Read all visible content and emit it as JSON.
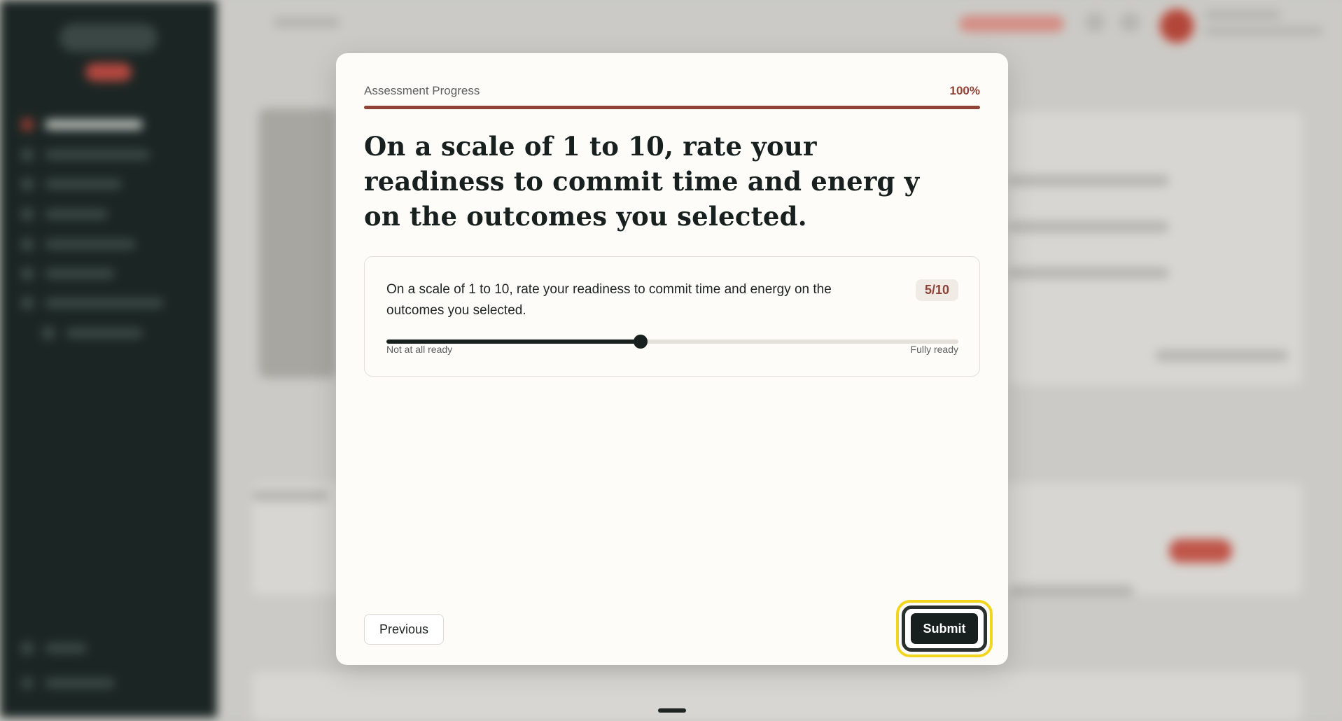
{
  "assessment": {
    "progress_label": "Assessment Progress",
    "progress_percent_text": "100%",
    "progress_value": 1.0,
    "title": "On a scale of 1 to 10, rate your readiness to commit time and energ y on the outcomes you selected.",
    "question": {
      "text": "On a scale of 1 to 10, rate your readiness to commit time and energy on the outcomes you selected.",
      "score_text": "5/10",
      "slider": {
        "min": 1,
        "max": 10,
        "value": 5,
        "min_label": "Not at all ready",
        "max_label": "Fully ready"
      }
    }
  },
  "actions": {
    "previous_label": "Previous",
    "submit_label": "Submit"
  },
  "colors": {
    "accent": "#8f4236",
    "dark": "#17201e",
    "focus_ring": "#f2d51f",
    "sidebar": "#1b2624"
  }
}
